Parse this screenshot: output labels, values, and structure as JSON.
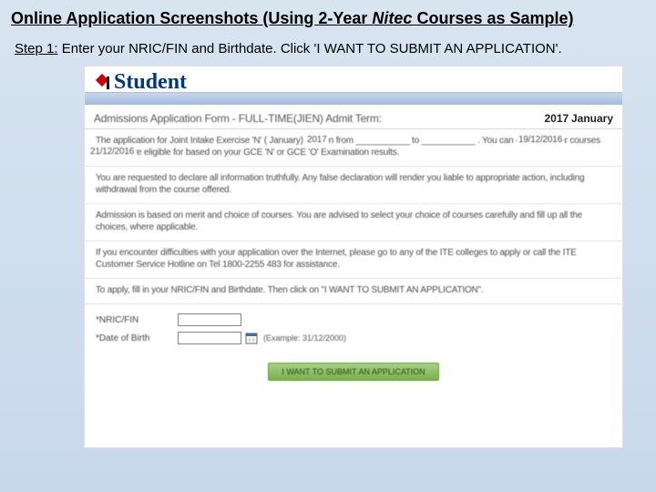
{
  "title": {
    "part1": "Online Application Screenshots (Using 2-Year ",
    "italic": "Nitec",
    "part2": " Courses as Sample)"
  },
  "step": {
    "label": "Step 1:",
    "text": " Enter your NRIC/FIN and Birthdate. Click 'I WANT TO SUBMIT AN APPLICATION'."
  },
  "screenshot": {
    "logo": "Student",
    "form_title": "Admissions Application Form - FULL-TIME(JIEN)   Admit Term:",
    "term_year": "2017",
    "term_month": "January",
    "year_inline": "2017",
    "date_start": "19/12/2016",
    "date_end": "21/12/2016",
    "para1": "The application for Joint Intake Exercise 'N' (      January) is open from ___________ to ___________ . You can only apply for courses that you are eligible for based on your GCE 'N' or GCE 'O' Examination results.",
    "para2": "You are requested to declare all information truthfully. Any false declaration will render you liable to appropriate action, including withdrawal from the course offered.",
    "para3": "Admission is based on merit and choice of courses. You are advised to select your choice of courses carefully and fill up all the choices, where applicable.",
    "para4": "If you encounter difficulties with your application over the Internet, please go to any of the ITE colleges to apply or call the ITE Customer Service Hotline on Tel 1800-2255 483 for assistance.",
    "para5": "To apply, fill in your NRIC/FIN and Birthdate. Then click on \"I WANT TO SUBMIT AN APPLICATION\".",
    "fields": {
      "nric_label": "*NRIC/FIN",
      "dob_label": "*Date of Birth",
      "dob_example": "(Example: 31/12/2000)"
    },
    "submit_label": "I WANT TO SUBMIT AN APPLICATION"
  }
}
